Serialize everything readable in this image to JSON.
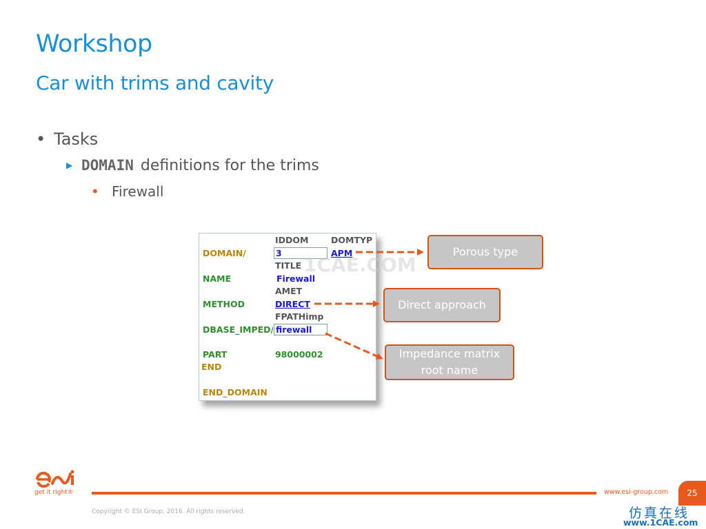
{
  "slide": {
    "title": "Workshop",
    "subtitle": "Car with trims and cavity",
    "bullet1": "Tasks",
    "bullet2_code": "DOMAIN",
    "bullet2_text": "definitions for the trims",
    "bullet3": "Firewall"
  },
  "panel": {
    "header_iddom": "IDDOM",
    "header_domtyp": "DOMTYP",
    "kw_domain": "DOMAIN/",
    "val_iddom": "3",
    "val_domtyp": "APM",
    "header_title": "TITLE",
    "kw_name": "NAME",
    "val_name": "Firewall",
    "header_amet": "AMET",
    "kw_method": "METHOD",
    "val_method": "DIRECT",
    "header_fpath": "FPATHimp",
    "kw_dbase": "DBASE_IMPED/",
    "val_dbase": "firewall",
    "kw_part": "PART",
    "val_part": "98000002",
    "kw_end": "END",
    "kw_end_domain": "END_DOMAIN",
    "watermark": "1CAE.COM"
  },
  "callouts": {
    "porous": "Porous type",
    "direct": "Direct approach",
    "impedance_line1": "Impedance matrix",
    "impedance_line2": "root name"
  },
  "footer": {
    "tagline": "get it right®",
    "url": "www.esi-group.com",
    "page_number": "25",
    "copyright": "Copyright © ESI Group, 2016. All rights reserved.",
    "watermark_cn": "仿真在线",
    "watermark_url": "www.1CAE.com"
  },
  "colors": {
    "accent_blue": "#1a8fd6",
    "accent_orange": "#e85a1c"
  }
}
